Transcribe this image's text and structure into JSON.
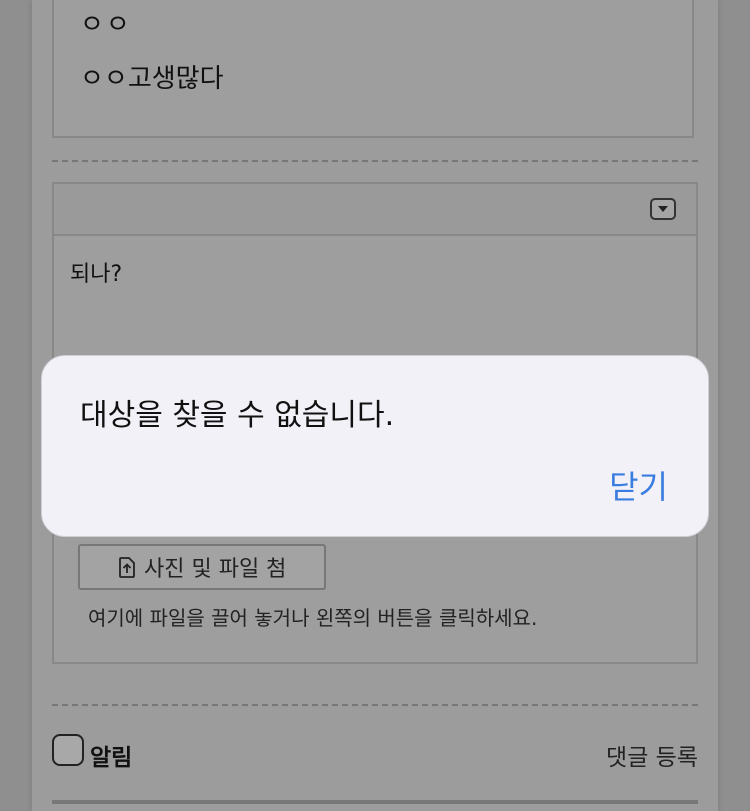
{
  "previous_comment": {
    "line1": "ㅇㅇ",
    "line2": "ㅇㅇ고생많다"
  },
  "editor": {
    "text": "되나?",
    "attach_button_label": "사진 및 파일 첨",
    "attach_hint": "여기에 파일을 끌어 놓거나 왼쪽의 버튼을 클릭하세요."
  },
  "footer": {
    "notify_label": "알림",
    "submit_label": "댓글 등록"
  },
  "dialog": {
    "message": "대상을 찾을 수 없습니다.",
    "close_label": "닫기"
  },
  "colors": {
    "link_blue": "#3a7de0",
    "dialog_bg": "#f2f1f7"
  },
  "icons": {
    "dropdown": "chevron-down-icon",
    "upload": "upload-icon"
  }
}
